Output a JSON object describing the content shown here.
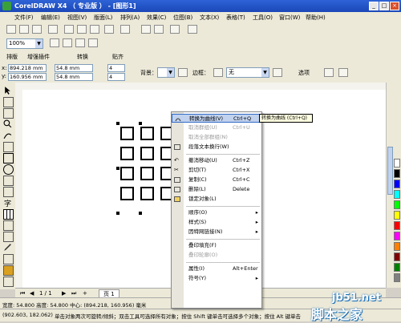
{
  "window": {
    "title": "CorelDRAW X4 （ 专业版 ） - [图形1]"
  },
  "menubar": [
    "文件(F)",
    "编辑(E)",
    "视图(V)",
    "版面(L)",
    "排列(A)",
    "效果(C)",
    "位图(B)",
    "文本(X)",
    "表格(T)",
    "工具(O)",
    "窗口(W)",
    "帮助(H)"
  ],
  "toolbar": {
    "zoom": "100%"
  },
  "plugins": {
    "tabs": [
      "排版",
      "增强插件",
      "转换",
      "贴齐"
    ]
  },
  "properties": {
    "x": "894.218 mm",
    "y": "160.956 mm",
    "w": "54.8 mm",
    "h": "54.8 mm",
    "cols": "4",
    "rows": "4",
    "bg_label": "背景：",
    "border_label": "边框：",
    "border_value": "无",
    "options_label": "选项"
  },
  "pagebar": {
    "counter": "1 / 1",
    "page_tab": "页 1"
  },
  "context_menu": {
    "items": [
      {
        "label": "转换为曲线(V)",
        "shortcut": "Ctrl+Q",
        "state": "highlighted"
      },
      {
        "label": "取消群组(U)",
        "shortcut": "Ctrl+U",
        "state": "disabled"
      },
      {
        "label": "取消全部群组(N)",
        "shortcut": "",
        "state": "disabled"
      },
      {
        "label": "段落文本换行(W)",
        "shortcut": "",
        "state": "normal"
      },
      {
        "label": "撤消移动(U)",
        "shortcut": "Ctrl+Z",
        "state": "normal"
      },
      {
        "label": "剪切(T)",
        "shortcut": "Ctrl+X",
        "state": "normal"
      },
      {
        "label": "复制(C)",
        "shortcut": "Ctrl+C",
        "state": "normal"
      },
      {
        "label": "删除(L)",
        "shortcut": "Delete",
        "state": "normal"
      },
      {
        "label": "锁定对象(L)",
        "shortcut": "",
        "state": "normal"
      },
      {
        "label": "顺序(O)",
        "shortcut": "",
        "state": "submenu"
      },
      {
        "label": "样式(S)",
        "shortcut": "",
        "state": "submenu"
      },
      {
        "label": "因特网链接(N)",
        "shortcut": "",
        "state": "submenu"
      },
      {
        "label": "叠印填充(F)",
        "shortcut": "",
        "state": "normal"
      },
      {
        "label": "叠印轮廓(O)",
        "shortcut": "",
        "state": "disabled"
      },
      {
        "label": "属性(I)",
        "shortcut": "Alt+Enter",
        "state": "normal"
      },
      {
        "label": "符号(Y)",
        "shortcut": "",
        "state": "submenu"
      }
    ],
    "tooltip": "转换为曲线 (Ctrl+Q)"
  },
  "status": {
    "dimensions": "宽度: 54.800 高度: 54.800 中心: (894.218, 160.956) 毫米",
    "cursor": "(902.603, 182.062)",
    "hint": "单击对象两次可旋转/倾斜；双击工具可选择所有对象；按住 Shift 键单击可选择多个对象；按住 Alt 键单击"
  },
  "watermark": {
    "site": "jb51.net",
    "name": "脚本之家"
  },
  "colors": {
    "title_bar": "#1b47b8",
    "menu_highlight": "#c1d2ee",
    "palette": [
      "#ffffff",
      "#000000",
      "#0000ff",
      "#00ffff",
      "#00ff00",
      "#ffff00",
      "#ff0000",
      "#ff00ff",
      "#ff8000",
      "#800000",
      "#008000",
      "#808080"
    ]
  }
}
